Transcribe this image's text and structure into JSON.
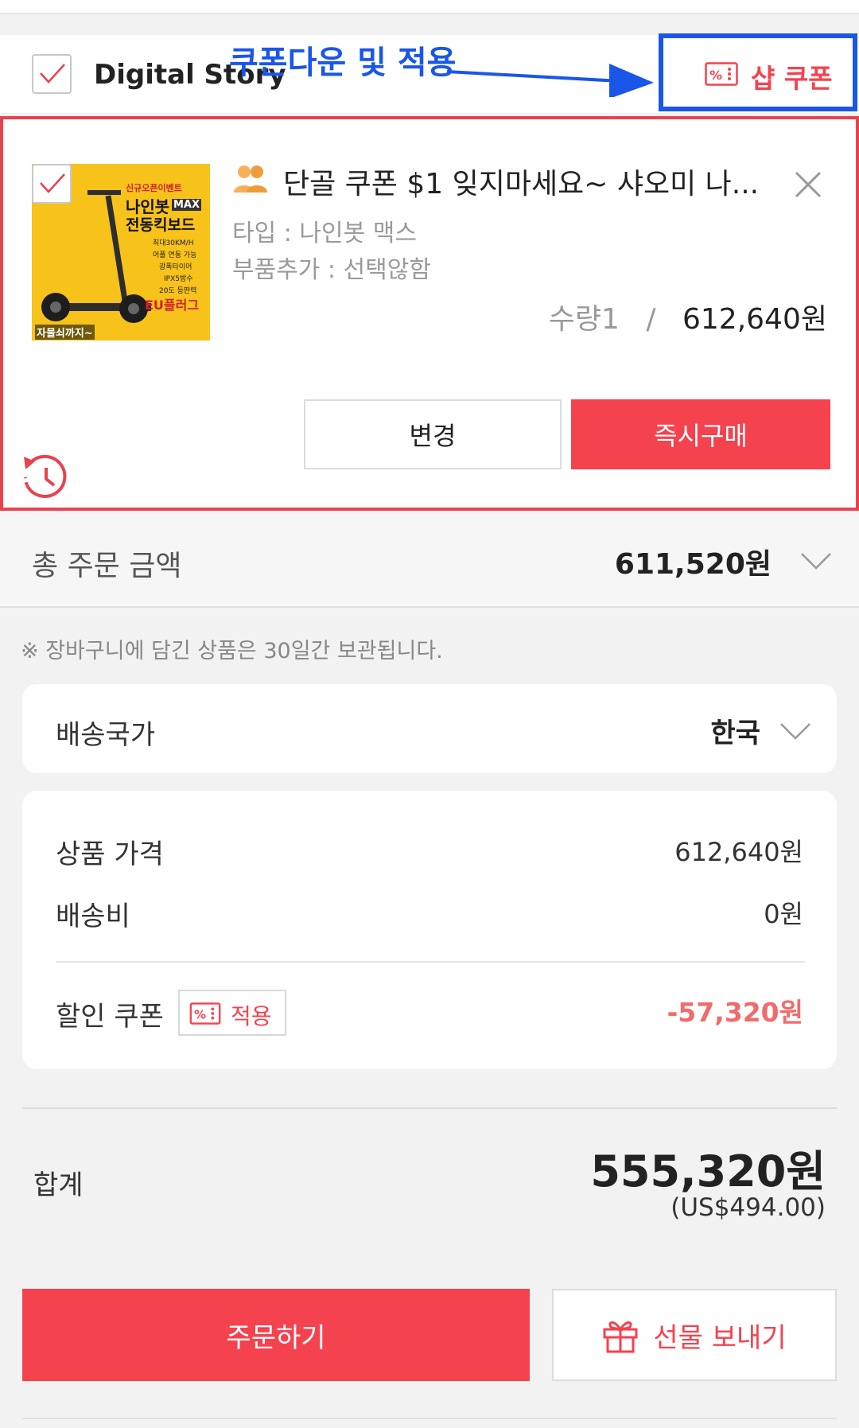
{
  "seller": {
    "name": "Digital Story",
    "shop_coupon_label": "샵 쿠폰"
  },
  "annotation": {
    "text": "쿠폰다운 및 적용"
  },
  "product": {
    "image_lines": [
      "신규오픈이벤트",
      "나인봇",
      "MAX",
      "전동킥보드",
      "최대30KM/H",
      "어플 연동 가능",
      "광폭타이어",
      "IPX5방수",
      "20도 등판력",
      "EU플러그",
      "자물쇠까지~"
    ],
    "title": "단골 쿠폰 $1 잊지마세요~ 샤오미 나...",
    "option_type": "타입 : 나인봇 맥스",
    "option_parts": "부품추가 : 선택않함",
    "quantity": "수량1",
    "separator": "/",
    "price": "612,640원",
    "change_button": "변경",
    "buy_now_button": "즉시구매"
  },
  "total_order": {
    "label": "총 주문 금액",
    "amount": "611,520원"
  },
  "notice": "※ 장바구니에 담긴 상품은 30일간 보관됩니다.",
  "shipping": {
    "label": "배송국가",
    "value": "한국"
  },
  "summary": {
    "price_label": "상품 가격",
    "price_value": "612,640원",
    "shipping_label": "배송비",
    "shipping_value": "0원",
    "coupon_label": "할인 쿠폰",
    "coupon_apply": "적용",
    "coupon_value": "-57,320원"
  },
  "grand_total": {
    "label": "합계",
    "amount": "555,320원",
    "usd": "(US$494.00)"
  },
  "actions": {
    "order_button": "주문하기",
    "gift_button": "선물 보내기"
  },
  "colors": {
    "accent_red": "#f5424f",
    "annotation_blue": "#1a56e8"
  }
}
